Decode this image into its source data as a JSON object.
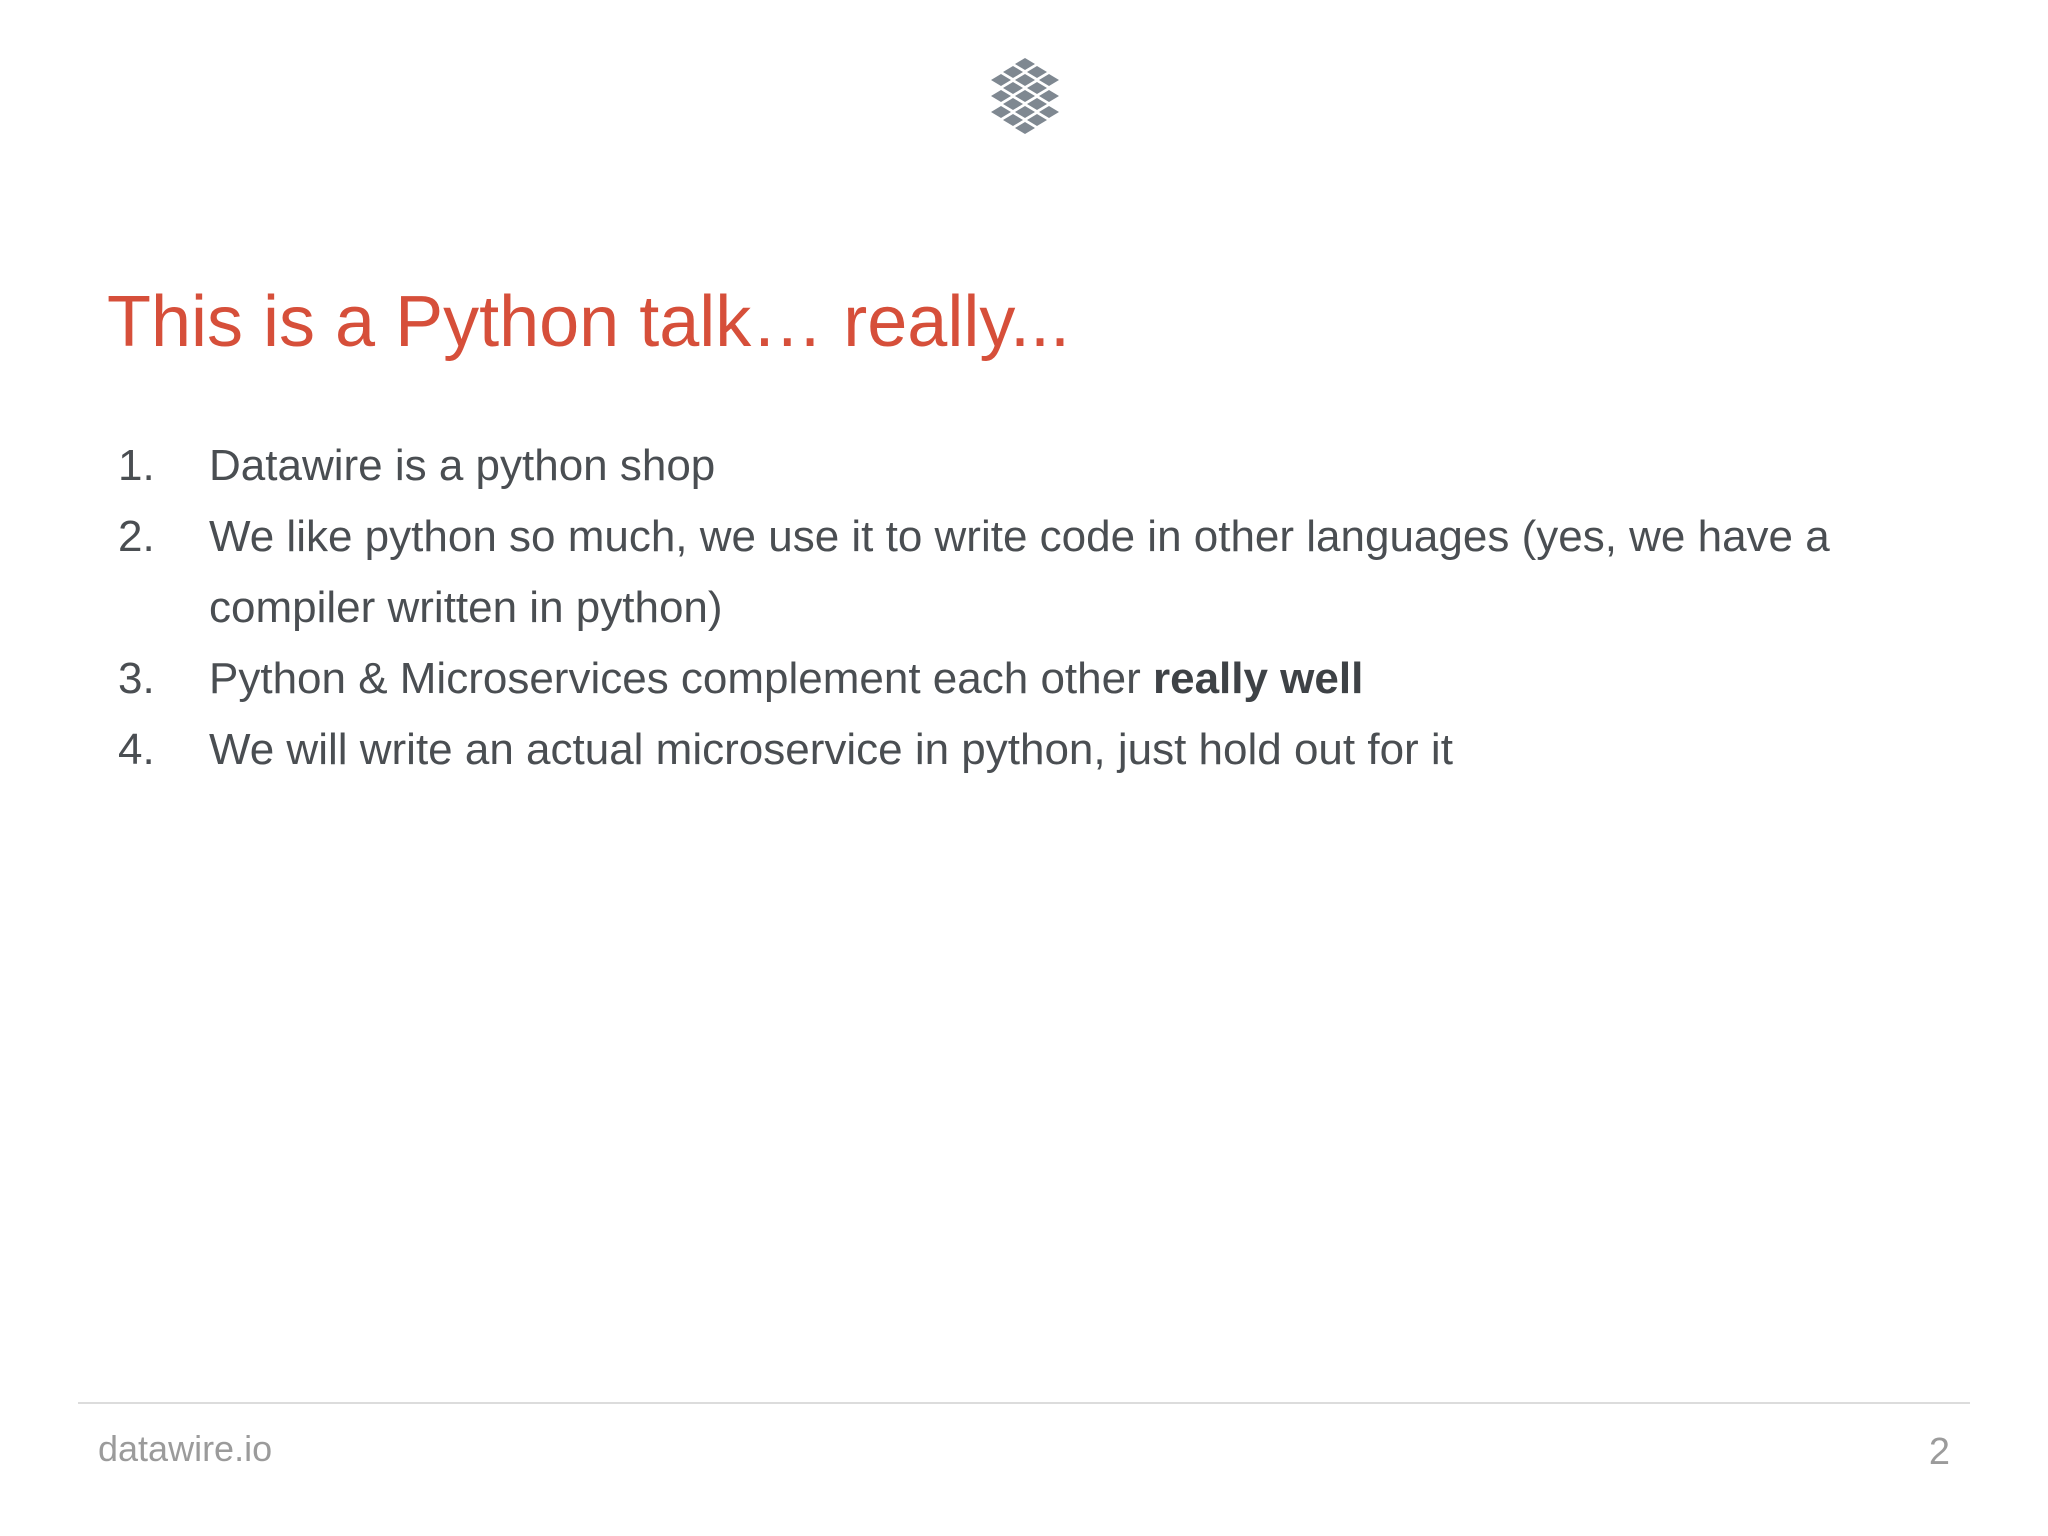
{
  "slide": {
    "logo_icon": "datawire-lattice-logo-icon",
    "title": "This is a Python talk… really...",
    "items": [
      {
        "number": "1.",
        "text": "Datawire is a python shop",
        "emphasis": ""
      },
      {
        "number": "2.",
        "text": "We like python so much, we use it to write code in other languages (yes, we have a compiler written in python)",
        "emphasis": ""
      },
      {
        "number": "3.",
        "text": "Python & Microservices complement each other ",
        "emphasis": "really well"
      },
      {
        "number": "4.",
        "text": "We will write an actual microservice in python, just hold out for it",
        "emphasis": ""
      }
    ],
    "footer": {
      "site": "datawire.io",
      "page_number": "2"
    },
    "colors": {
      "title": "#d64f3a",
      "body_text": "#4a4e52",
      "logo": "#7f8891",
      "footer_text": "#9b9b9b"
    }
  }
}
